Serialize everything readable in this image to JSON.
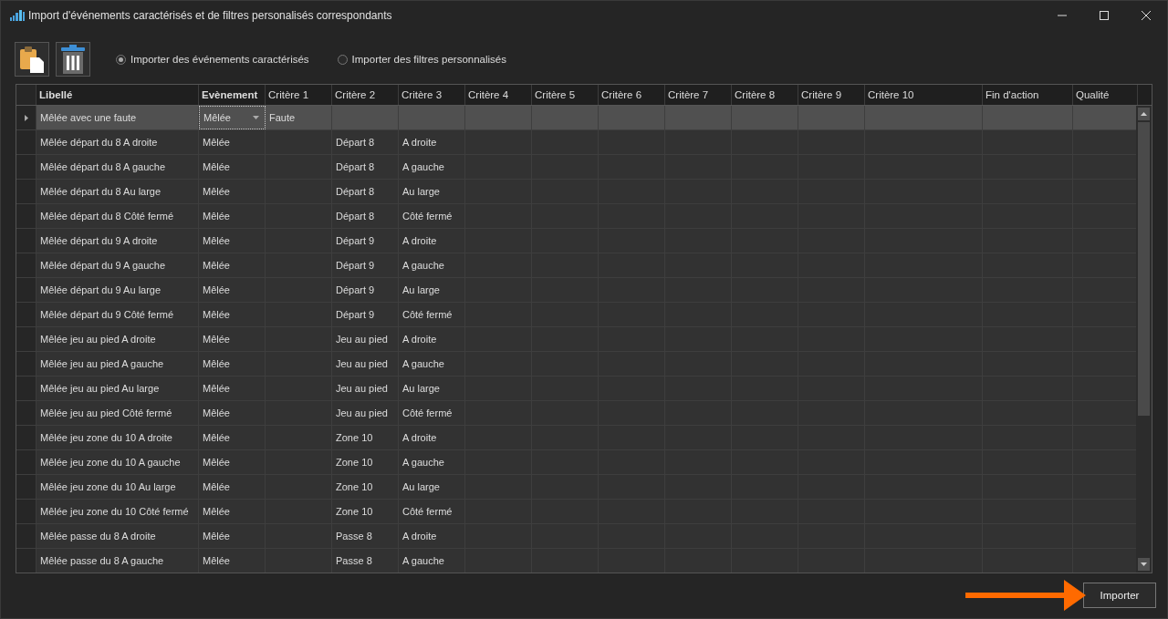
{
  "window": {
    "title": "Import d'événements caractérisés et de filtres personalisés correspondants"
  },
  "import_options": [
    {
      "label": "Importer des événements caractérisés",
      "selected": true
    },
    {
      "label": "Importer des filtres personnalisés",
      "selected": false
    }
  ],
  "table": {
    "columns": [
      "Libellé",
      "Evènement",
      "Critère 1",
      "Critère 2",
      "Critère 3",
      "Critère 4",
      "Critère 5",
      "Critère 6",
      "Critère 7",
      "Critère 8",
      "Critère 9",
      "Critère 10",
      "Fin d'action",
      "Qualité"
    ],
    "rows": [
      {
        "selected": true,
        "cells": [
          "Mêlée avec une faute",
          "Mêlée",
          "Faute"
        ]
      },
      {
        "selected": false,
        "cells": [
          "Mêlée départ du 8 A droite",
          "Mêlée",
          null,
          "Départ 8",
          "A droite"
        ]
      },
      {
        "selected": false,
        "cells": [
          "Mêlée départ du 8 A gauche",
          "Mêlée",
          null,
          "Départ 8",
          "A gauche"
        ]
      },
      {
        "selected": false,
        "cells": [
          "Mêlée départ du 8 Au large",
          "Mêlée",
          null,
          "Départ 8",
          "Au large"
        ]
      },
      {
        "selected": false,
        "cells": [
          "Mêlée départ du 8 Côté fermé",
          "Mêlée",
          null,
          "Départ 8",
          "Côté fermé"
        ]
      },
      {
        "selected": false,
        "cells": [
          "Mêlée départ du 9 A droite",
          "Mêlée",
          null,
          "Départ 9",
          "A droite"
        ]
      },
      {
        "selected": false,
        "cells": [
          "Mêlée départ du 9 A gauche",
          "Mêlée",
          null,
          "Départ 9",
          "A gauche"
        ]
      },
      {
        "selected": false,
        "cells": [
          "Mêlée départ du 9 Au large",
          "Mêlée",
          null,
          "Départ 9",
          "Au large"
        ]
      },
      {
        "selected": false,
        "cells": [
          "Mêlée départ du 9 Côté fermé",
          "Mêlée",
          null,
          "Départ 9",
          "Côté fermé"
        ]
      },
      {
        "selected": false,
        "cells": [
          "Mêlée jeu au pied A droite",
          "Mêlée",
          null,
          "Jeu au pied",
          "A droite"
        ]
      },
      {
        "selected": false,
        "cells": [
          "Mêlée jeu au pied A gauche",
          "Mêlée",
          null,
          "Jeu au pied",
          "A gauche"
        ]
      },
      {
        "selected": false,
        "cells": [
          "Mêlée jeu au pied Au large",
          "Mêlée",
          null,
          "Jeu au pied",
          "Au large"
        ]
      },
      {
        "selected": false,
        "cells": [
          "Mêlée jeu au pied Côté fermé",
          "Mêlée",
          null,
          "Jeu au pied",
          "Côté fermé"
        ]
      },
      {
        "selected": false,
        "cells": [
          "Mêlée jeu zone du 10 A droite",
          "Mêlée",
          null,
          "Zone 10",
          "A droite"
        ]
      },
      {
        "selected": false,
        "cells": [
          "Mêlée jeu zone du 10 A gauche",
          "Mêlée",
          null,
          "Zone 10",
          "A gauche"
        ]
      },
      {
        "selected": false,
        "cells": [
          "Mêlée jeu zone du 10 Au large",
          "Mêlée",
          null,
          "Zone 10",
          "Au large"
        ]
      },
      {
        "selected": false,
        "cells": [
          "Mêlée jeu zone du 10 Côté fermé",
          "Mêlée",
          null,
          "Zone 10",
          "Côté fermé"
        ]
      },
      {
        "selected": false,
        "cells": [
          "Mêlée passe du 8 A droite",
          "Mêlée",
          null,
          "Passe 8",
          "A droite"
        ]
      },
      {
        "selected": false,
        "cells": [
          "Mêlée passe du 8 A gauche",
          "Mêlée",
          null,
          "Passe 8",
          "A gauche"
        ]
      }
    ]
  },
  "buttons": [
    "Importer"
  ]
}
